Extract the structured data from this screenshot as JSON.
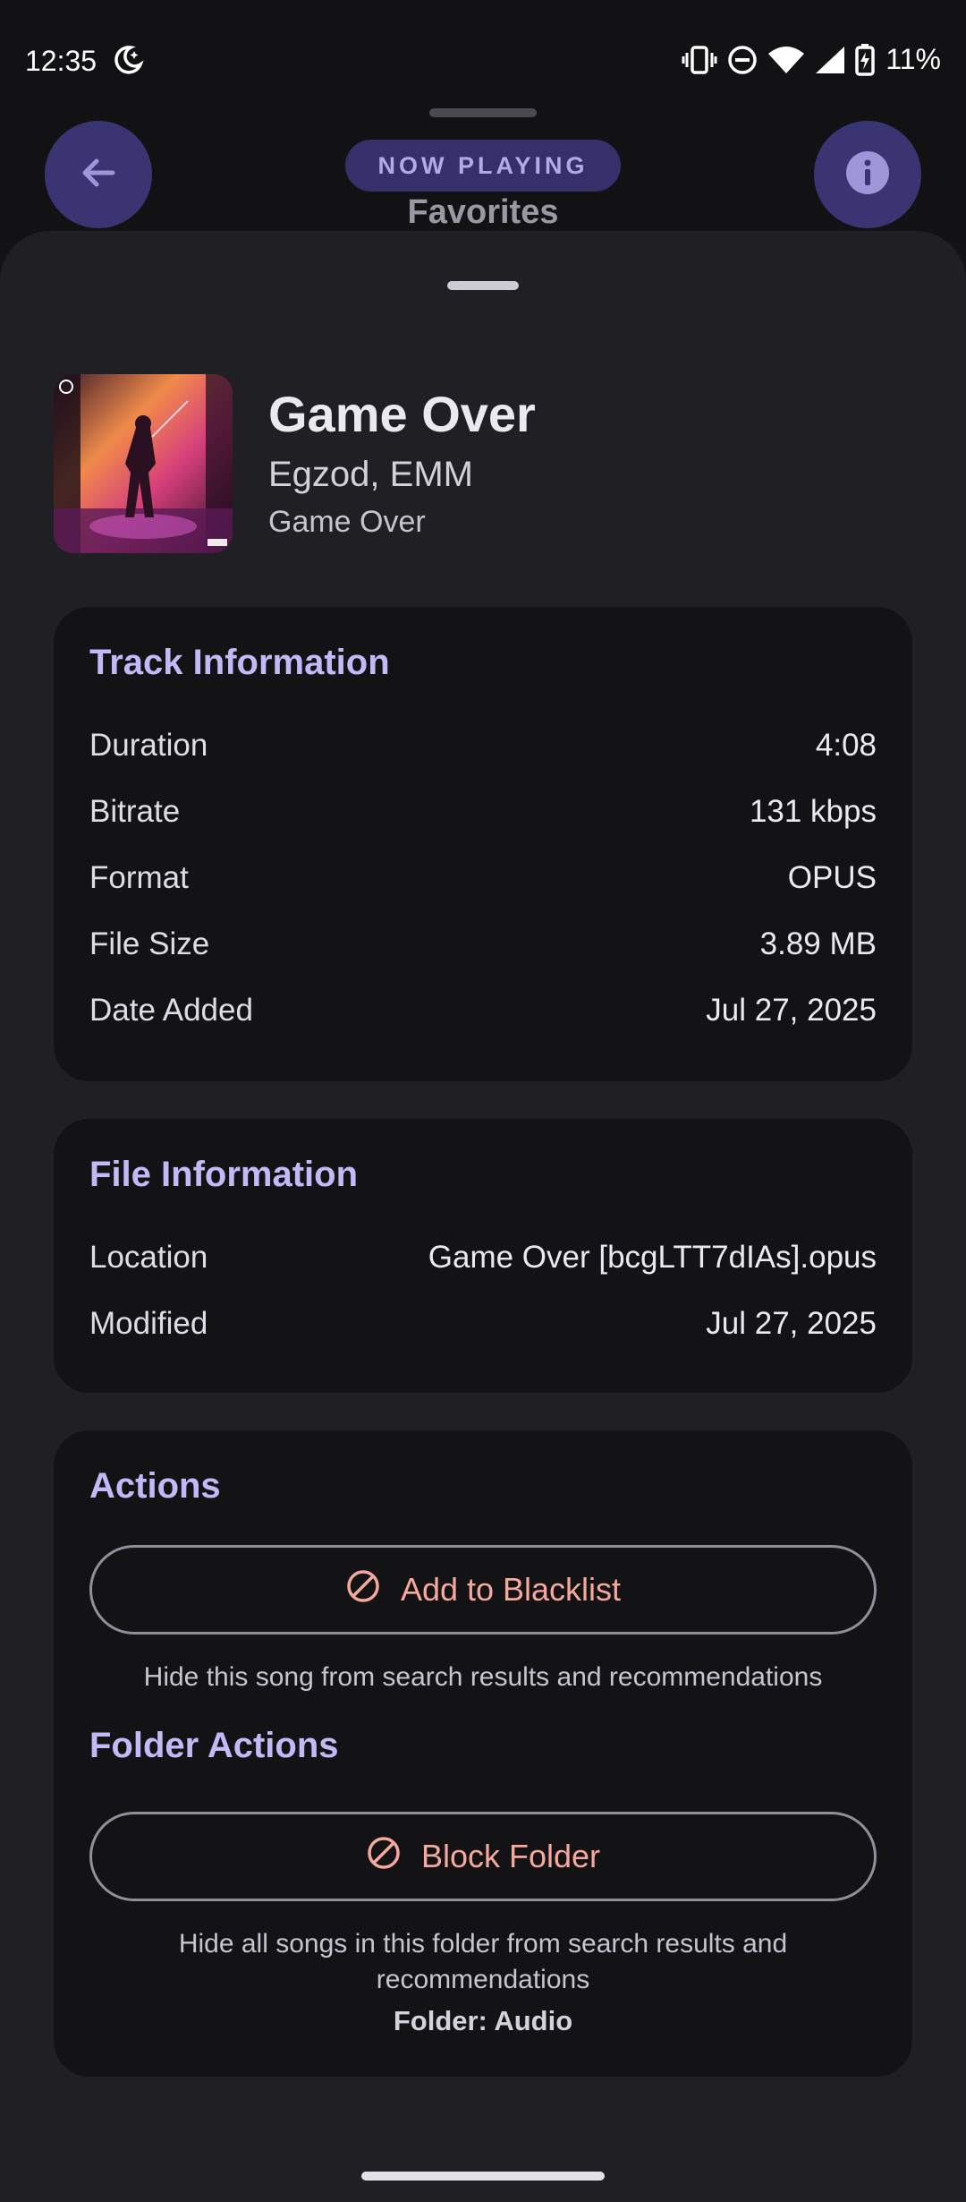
{
  "status_bar": {
    "time": "12:35",
    "battery": "11%"
  },
  "header": {
    "chip_label": "NOW PLAYING",
    "playlist": "Favorites"
  },
  "track": {
    "title": "Game Over",
    "artist": "Egzod, EMM",
    "album": "Game Over"
  },
  "track_info": {
    "title": "Track Information",
    "rows": [
      {
        "label": "Duration",
        "value": "4:08"
      },
      {
        "label": "Bitrate",
        "value": "131 kbps"
      },
      {
        "label": "Format",
        "value": "OPUS"
      },
      {
        "label": "File Size",
        "value": "3.89 MB"
      },
      {
        "label": "Date Added",
        "value": "Jul 27, 2025"
      }
    ]
  },
  "file_info": {
    "title": "File Information",
    "rows": [
      {
        "label": "Location",
        "value": "Game Over [bcgLTT7dIAs].opus"
      },
      {
        "label": "Modified",
        "value": "Jul 27, 2025"
      }
    ]
  },
  "actions": {
    "title": "Actions",
    "blacklist_label": "Add to Blacklist",
    "blacklist_caption": "Hide this song from search results and recommendations",
    "folder_title": "Folder Actions",
    "block_folder_label": "Block Folder",
    "folder_caption_line1": "Hide all songs in this folder from search results and",
    "folder_caption_line2": "recommendations",
    "folder_name": "Folder: Audio"
  },
  "colors": {
    "accent": "#c5b8f7",
    "action": "#f5a99c",
    "button_bg": "#3a3473",
    "card_bg": "#131316",
    "sheet_bg": "#1f1f24"
  },
  "icons": [
    "moon-icon",
    "vibrate-icon",
    "dnd-icon",
    "wifi-icon",
    "signal-icon",
    "battery-charging-icon",
    "back-arrow-icon",
    "info-icon",
    "block-icon"
  ]
}
